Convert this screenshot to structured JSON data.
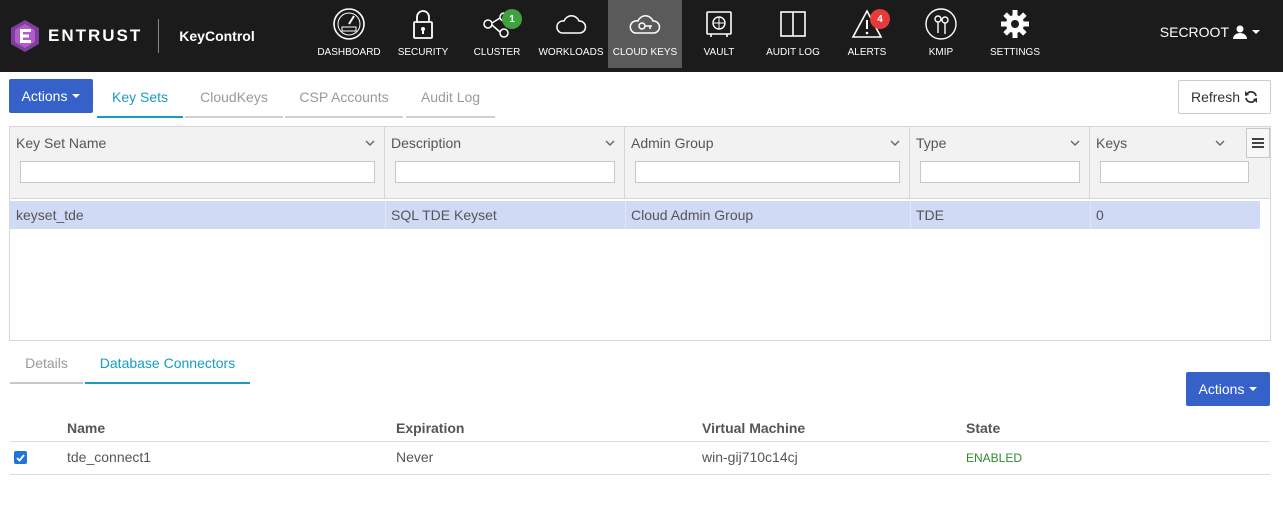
{
  "brand": {
    "name": "ENTRUST",
    "product": "KeyControl"
  },
  "nav": [
    {
      "label": "DASHBOARD",
      "icon": "dashboard-gauge-icon"
    },
    {
      "label": "SECURITY",
      "icon": "padlock-icon"
    },
    {
      "label": "CLUSTER",
      "icon": "cluster-nodes-icon",
      "badge": "1",
      "badge_color": "#3ea33e"
    },
    {
      "label": "WORKLOADS",
      "icon": "cloud-icon"
    },
    {
      "label": "CLOUD KEYS",
      "icon": "cloud-key-icon",
      "active": true
    },
    {
      "label": "VAULT",
      "icon": "vault-icon"
    },
    {
      "label": "AUDIT LOG",
      "icon": "book-icon"
    },
    {
      "label": "ALERTS",
      "icon": "warning-triangle-icon",
      "badge": "4",
      "badge_color": "#e63b3b"
    },
    {
      "label": "KMIP",
      "icon": "keys-icon"
    },
    {
      "label": "SETTINGS",
      "icon": "gear-icon"
    }
  ],
  "user": {
    "name": "SECROOT"
  },
  "toolbar": {
    "actions_label": "Actions",
    "tabs": [
      "Key Sets",
      "CloudKeys",
      "CSP Accounts",
      "Audit Log"
    ],
    "active_tab": "Key Sets",
    "refresh_label": "Refresh"
  },
  "grid": {
    "columns": [
      "Key Set Name",
      "Description",
      "Admin Group",
      "Type",
      "Keys"
    ],
    "rows": [
      [
        "keyset_tde",
        "SQL TDE Keyset",
        "Cloud Admin Group",
        "TDE",
        "0"
      ]
    ]
  },
  "details": {
    "tabs": [
      "Details",
      "Database Connectors"
    ],
    "active_tab": "Database Connectors",
    "actions_label": "Actions",
    "columns": [
      "Name",
      "Expiration",
      "Virtual Machine",
      "State"
    ],
    "rows": [
      {
        "checked": true,
        "name": "tde_connect1",
        "expiration": "Never",
        "vm": "win-gij710c14cj",
        "state": "ENABLED"
      }
    ]
  },
  "colors": {
    "primary": "#3561c8",
    "accent": "#1a9bbf",
    "selected_row": "#d0daf4",
    "enabled": "#2e8b2e"
  }
}
